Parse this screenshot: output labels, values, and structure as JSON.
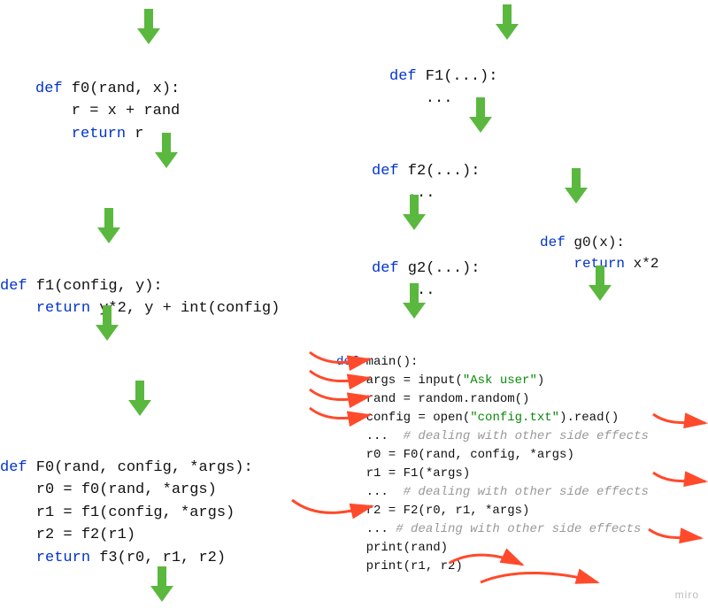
{
  "watermark": "miro",
  "colors": {
    "keyword": "#0033cc",
    "string": "#0a8a0a",
    "comment": "#999999",
    "arrow_green": "#5ab83f",
    "arrow_red": "#ff4a2b"
  },
  "code": {
    "f0": {
      "l1_def": "def",
      "l1_rest": " f0(rand, x):",
      "l2": "    r = x + rand",
      "l3_ret": "    return",
      "l3_rest": " r"
    },
    "f1": {
      "l1_def": "def",
      "l1_rest": " f1(config, y):",
      "l2_ret": "    return",
      "l2_rest": " y*2, y + int(config)"
    },
    "F0": {
      "l1_def": "def",
      "l1_rest": " F0(rand, config, *args):",
      "l2": "    r0 = f0(rand, *args)",
      "l3": "    r1 = f1(config, *args)",
      "l4": "    r2 = f2(r1)",
      "l5_ret": "    return",
      "l5_rest": " f3(r0, r1, r2)"
    },
    "F1r": {
      "l1_def": "def",
      "l1_rest": " F1(...):",
      "l2": "    ..."
    },
    "f2r": {
      "l1_def": "def",
      "l1_rest": " f2(...):",
      "l2": "    ..."
    },
    "g2r": {
      "l1_def": "def",
      "l1_rest": " g2(...):",
      "l2": "    ..."
    },
    "g0": {
      "l1_def": "def",
      "l1_rest": " g0(x):",
      "l2_ret": "    return",
      "l2_rest": " x*2"
    },
    "main": {
      "l1_def": "def",
      "l1_rest": " main():",
      "l2a": "    args = input(",
      "l2s": "\"Ask user\"",
      "l2b": ")",
      "l3": "    rand = random.random()",
      "l4a": "    config = open(",
      "l4s": "\"config.txt\"",
      "l4b": ").read()",
      "l5a": "    ... ",
      "l5c": " # dealing with other side effects",
      "l6": "    r0 = F0(rand, config, *args)",
      "l7": "    r1 = F1(*args)",
      "l8a": "    ... ",
      "l8c": " # dealing with other side effects",
      "l9": "    r2 = F2(r0, r1, *args)",
      "l10a": "    ...",
      "l10c": " # dealing with other side effects",
      "l11": "    print(rand)",
      "l12": "    print(r1, r2)"
    }
  }
}
